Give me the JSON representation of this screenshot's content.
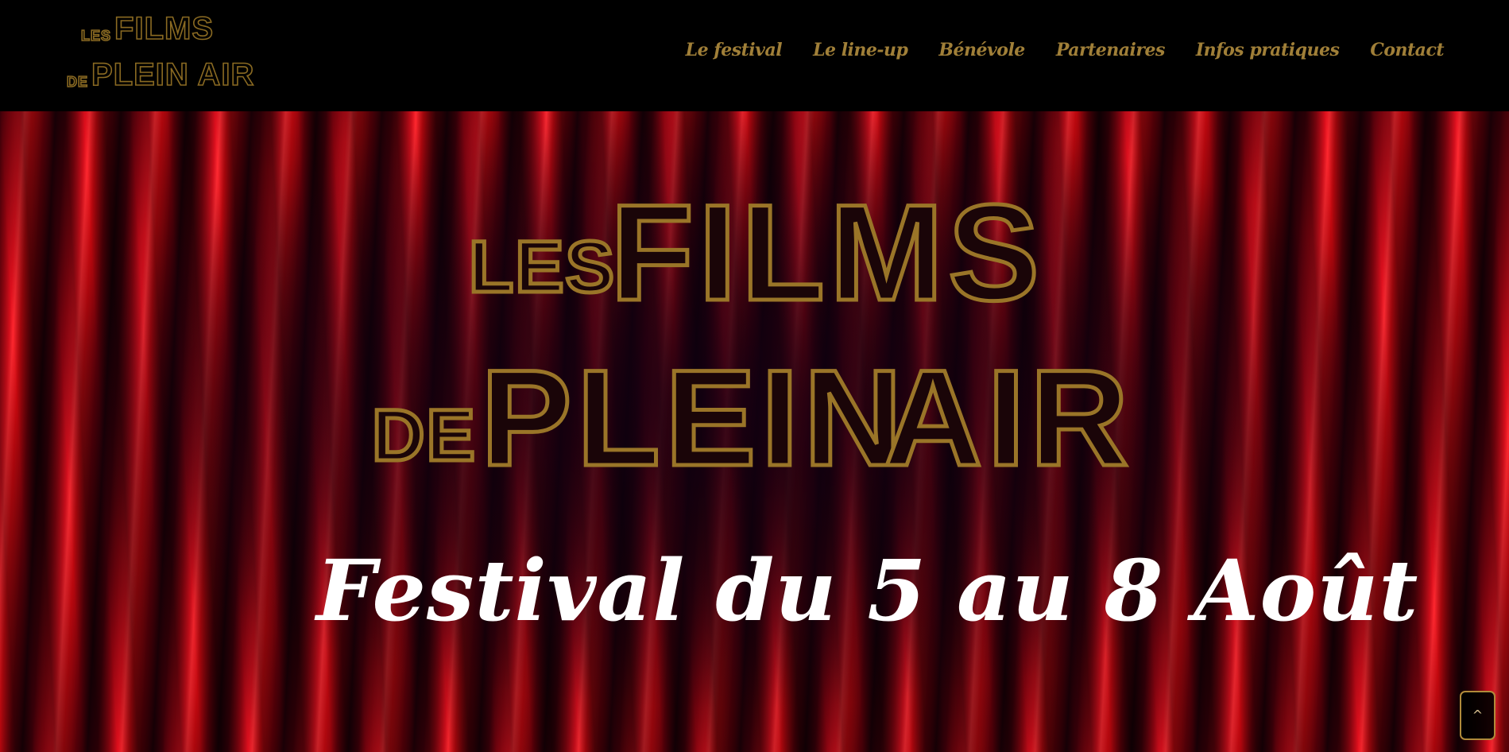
{
  "header": {
    "logo": {
      "line1_small": "LES",
      "line1_big": "FILMS",
      "line2_small": "DE",
      "line2_big": "PLEIN AIR"
    },
    "nav": [
      {
        "label": "Le festival"
      },
      {
        "label": "Le line-up"
      },
      {
        "label": "Bénévole"
      },
      {
        "label": "Partenaires"
      },
      {
        "label": "Infos pratiques"
      },
      {
        "label": "Contact"
      }
    ]
  },
  "hero": {
    "title_small_1": "LES",
    "title_big_1": "FILMS",
    "title_small_2": "DE",
    "title_big_2": "PLEIN",
    "title_big_3": "AIR",
    "dates": "Festival du 5 au 8 Août"
  },
  "back_to_top": {
    "label": "^"
  },
  "colors": {
    "gold": "#a07f38",
    "background": "#000000",
    "curtain_red": "#e0101e"
  }
}
